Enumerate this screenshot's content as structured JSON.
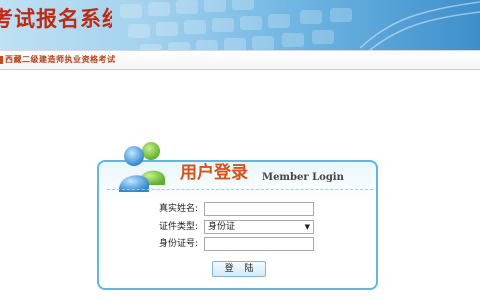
{
  "banner": {
    "title": "考试报名系统"
  },
  "subheader": {
    "title": "西藏二级建造师执业资格考试"
  },
  "login": {
    "title": "用户登录",
    "subtitle": "Member Login",
    "name_label": "真实姓名:",
    "name_value": "",
    "id_type_label": "证件类型:",
    "id_type_selected": "身份证",
    "id_number_label": "身份证号:",
    "id_number_value": "",
    "submit_label": "登 陆"
  },
  "icons": {
    "avatar": "user-group-icon",
    "select_arrow": "chevron-down-icon"
  },
  "colors": {
    "banner_title": "#c02a14",
    "subheader_text": "#b6401a",
    "login_title": "#d3531a",
    "box_border": "#62b8dc"
  }
}
